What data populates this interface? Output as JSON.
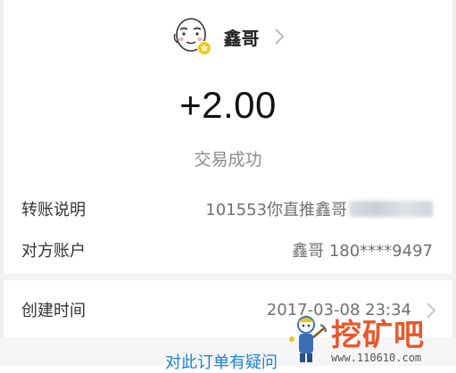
{
  "header": {
    "name": "鑫哥"
  },
  "transaction": {
    "amount": "+2.00",
    "status": "交易成功"
  },
  "details": {
    "note_label": "转账说明",
    "note_value": "101553你直推鑫哥",
    "account_label": "对方账户",
    "account_value": "鑫哥 180****9497",
    "time_label": "创建时间",
    "time_value": "2017-03-08 23:34"
  },
  "footer": {
    "question_link": "对此订单有疑问"
  },
  "watermark": {
    "title": "挖矿吧",
    "url": "www.110610.com"
  },
  "icons": {
    "avatar": "meme-face-avatar-icon",
    "badge": "star-badge-icon",
    "header_chevron": "chevron-right-icon",
    "row_chevron": "chevron-right-icon"
  },
  "colors": {
    "link": "#1e82d2",
    "status": "#8c8c8c",
    "badge": "#f5c518",
    "watermark": "#e8582a"
  }
}
